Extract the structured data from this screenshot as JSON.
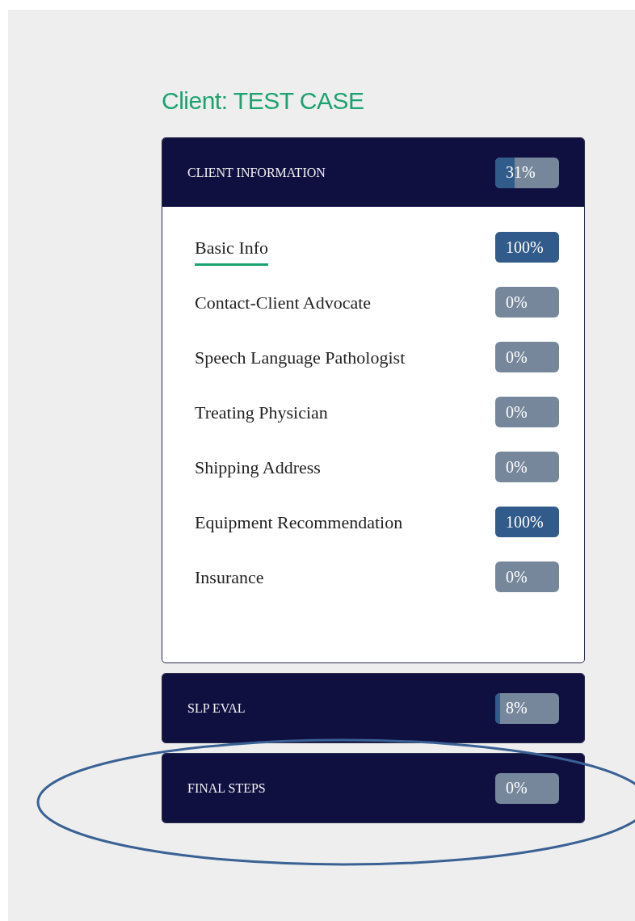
{
  "title": "Client: TEST CASE",
  "sections": [
    {
      "title": "CLIENT INFORMATION",
      "percent": "31%",
      "level": 0.31,
      "expanded": true,
      "items": [
        {
          "label": "Basic Info",
          "percent": "100%",
          "level": 1,
          "selected": true
        },
        {
          "label": "Contact-Client Advocate",
          "percent": "0%",
          "level": 0,
          "selected": false
        },
        {
          "label": "Speech Language Pathologist",
          "percent": "0%",
          "level": 0,
          "selected": false
        },
        {
          "label": "Treating Physician",
          "percent": "0%",
          "level": 0,
          "selected": false
        },
        {
          "label": "Shipping Address",
          "percent": "0%",
          "level": 0,
          "selected": false
        },
        {
          "label": "Equipment Recommendation",
          "percent": "100%",
          "level": 1,
          "selected": false
        },
        {
          "label": "Insurance",
          "percent": "0%",
          "level": 0,
          "selected": false
        }
      ]
    },
    {
      "title": "SLP EVAL",
      "percent": "8%",
      "level": 0.08,
      "expanded": false
    },
    {
      "title": "FINAL STEPS",
      "percent": "0%",
      "level": 0,
      "expanded": false
    }
  ],
  "annotation": {
    "kind": "ellipse"
  }
}
